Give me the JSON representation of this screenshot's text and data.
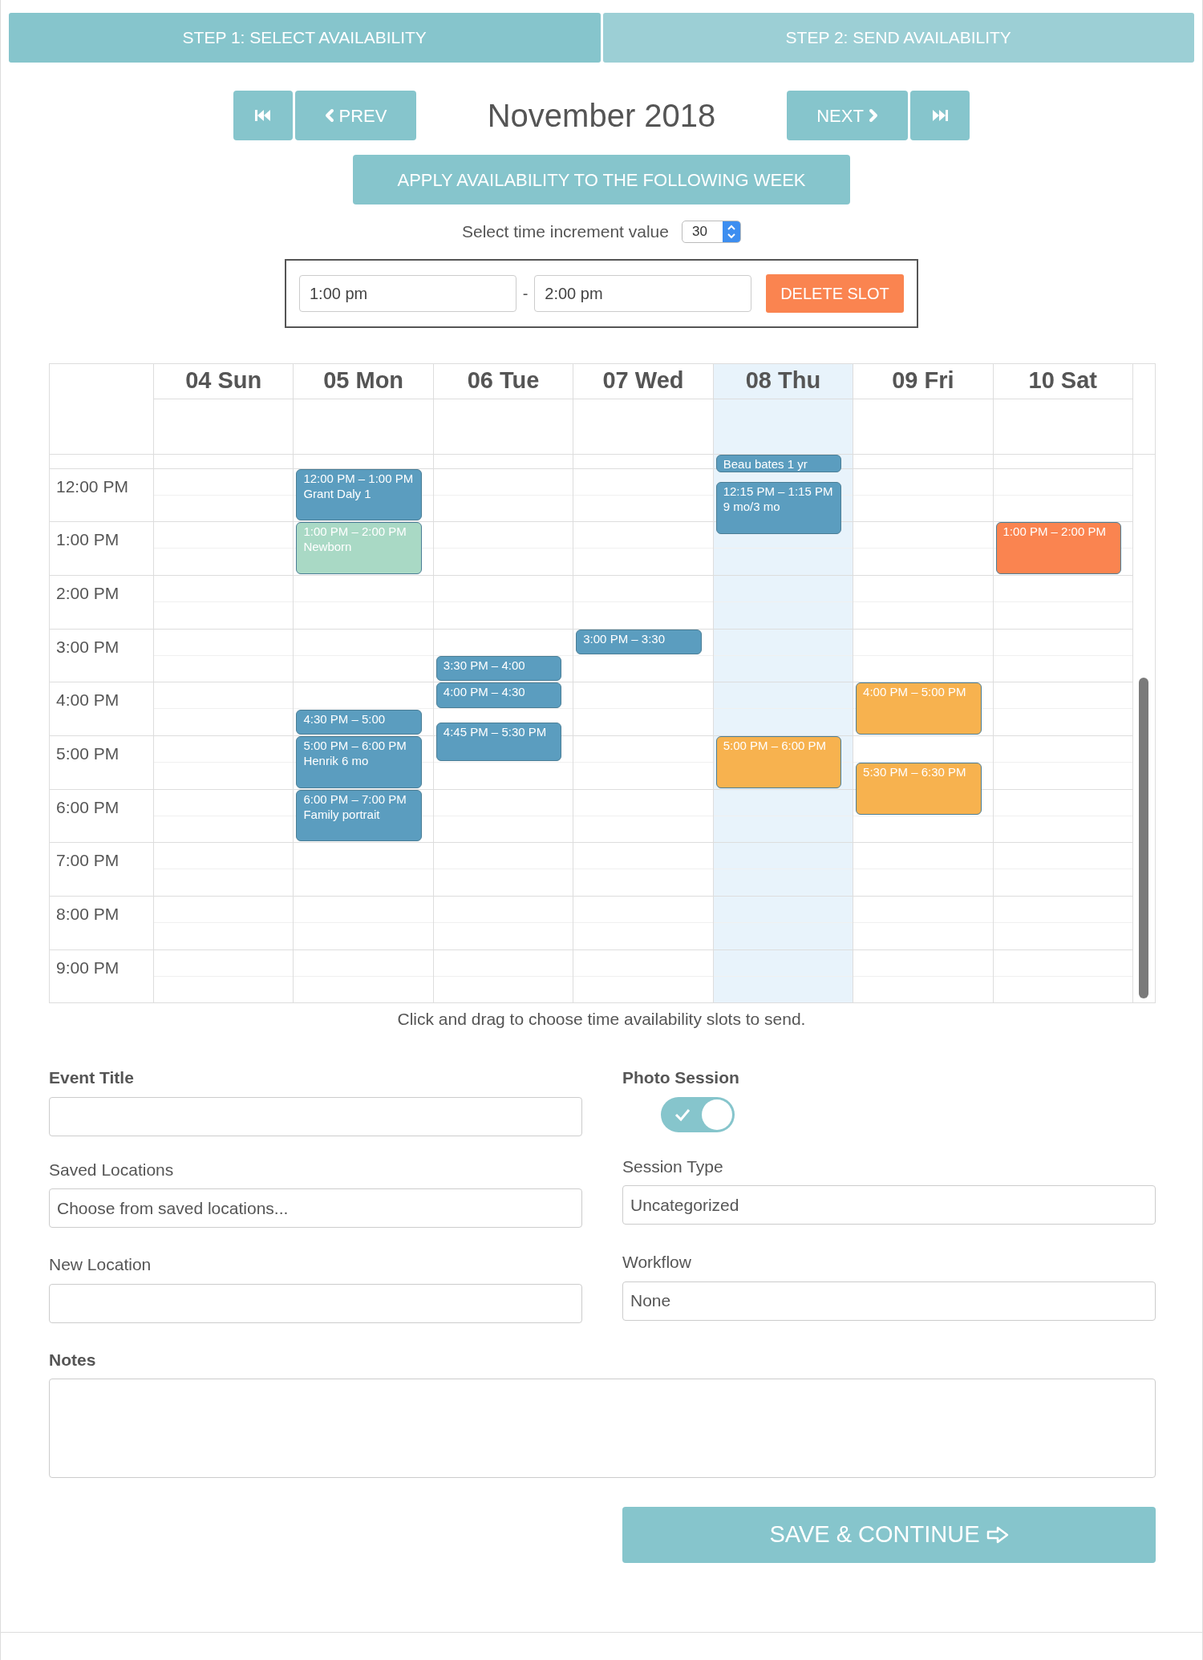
{
  "steps": [
    {
      "label": "STEP 1: SELECT AVAILABILITY",
      "selected": true
    },
    {
      "label": "STEP 2: SEND AVAILABILITY",
      "selected": false
    }
  ],
  "nav": {
    "prev": "PREV",
    "title": "November 2018",
    "next": "NEXT"
  },
  "apply_button": "APPLY AVAILABILITY TO THE FOLLOWING WEEK",
  "increment": {
    "label": "Select time increment value",
    "value": "30"
  },
  "slot": {
    "start": "1:00 pm",
    "separator": "-",
    "end": "2:00 pm",
    "delete": "DELETE SLOT"
  },
  "calendar": {
    "hours": [
      "12:00 PM",
      "1:00 PM",
      "2:00 PM",
      "3:00 PM",
      "4:00 PM",
      "5:00 PM",
      "6:00 PM",
      "7:00 PM",
      "8:00 PM",
      "9:00 PM"
    ],
    "days": [
      {
        "label": "04 Sun",
        "today": false
      },
      {
        "label": "05 Mon",
        "today": false,
        "events": [
          {
            "time": "12:00 PM – 1:00 PM",
            "title": "Grant Daly 1",
            "color": "#5b9dbf"
          },
          {
            "time": "1:00 PM – 2:00 PM",
            "title": "Newborn",
            "color": "#a9d9c5"
          },
          {
            "time": "4:30 PM – 5:00",
            "color": "#5b9dbf"
          },
          {
            "time": "5:00 PM – 6:00 PM",
            "title": "Henrik 6 mo",
            "color": "#5b9dbf"
          },
          {
            "time": "6:00 PM – 7:00 PM",
            "title": "Family portrait",
            "color": "#5b9dbf"
          }
        ]
      },
      {
        "label": "06 Tue",
        "today": false,
        "events": [
          {
            "time": "3:30 PM – 4:00",
            "color": "#5b9dbf"
          },
          {
            "time": "4:00 PM – 4:30",
            "color": "#5b9dbf"
          },
          {
            "time": "4:45 PM – 5:30 PM",
            "color": "#5b9dbf"
          }
        ]
      },
      {
        "label": "07 Wed",
        "today": false,
        "events": [
          {
            "time": "3:00 PM – 3:30",
            "color": "#5b9dbf"
          }
        ]
      },
      {
        "label": "08 Thu",
        "today": true,
        "events": [
          {
            "title": "Beau bates 1 yr",
            "color": "#5b9dbf"
          },
          {
            "time": "12:15 PM – 1:15 PM",
            "title": "9 mo/3 mo",
            "color": "#5b9dbf"
          },
          {
            "time": "5:00 PM – 6:00 PM",
            "color": "#f7b24f"
          }
        ]
      },
      {
        "label": "09 Fri",
        "today": false,
        "events": [
          {
            "time": "4:00 PM – 5:00 PM",
            "color": "#f7b24f"
          },
          {
            "time": "5:30 PM – 6:30 PM",
            "color": "#f7b24f"
          }
        ]
      },
      {
        "label": "10 Sat",
        "today": false,
        "events": [
          {
            "time": "1:00 PM – 2:00 PM",
            "color": "#fa8450"
          }
        ]
      }
    ]
  },
  "hint": "Click and drag to choose time availability slots to send.",
  "form": {
    "event_title": {
      "label": "Event Title"
    },
    "photo_session": {
      "label": "Photo Session",
      "on": true
    },
    "saved_locations": {
      "label": "Saved Locations",
      "value": "Choose from saved locations..."
    },
    "session_type": {
      "label": "Session Type",
      "value": "Uncategorized"
    },
    "new_location": {
      "label": "New Location"
    },
    "workflow": {
      "label": "Workflow",
      "value": "None"
    },
    "notes": {
      "label": "Notes"
    }
  },
  "save_button": "SAVE & CONTINUE"
}
